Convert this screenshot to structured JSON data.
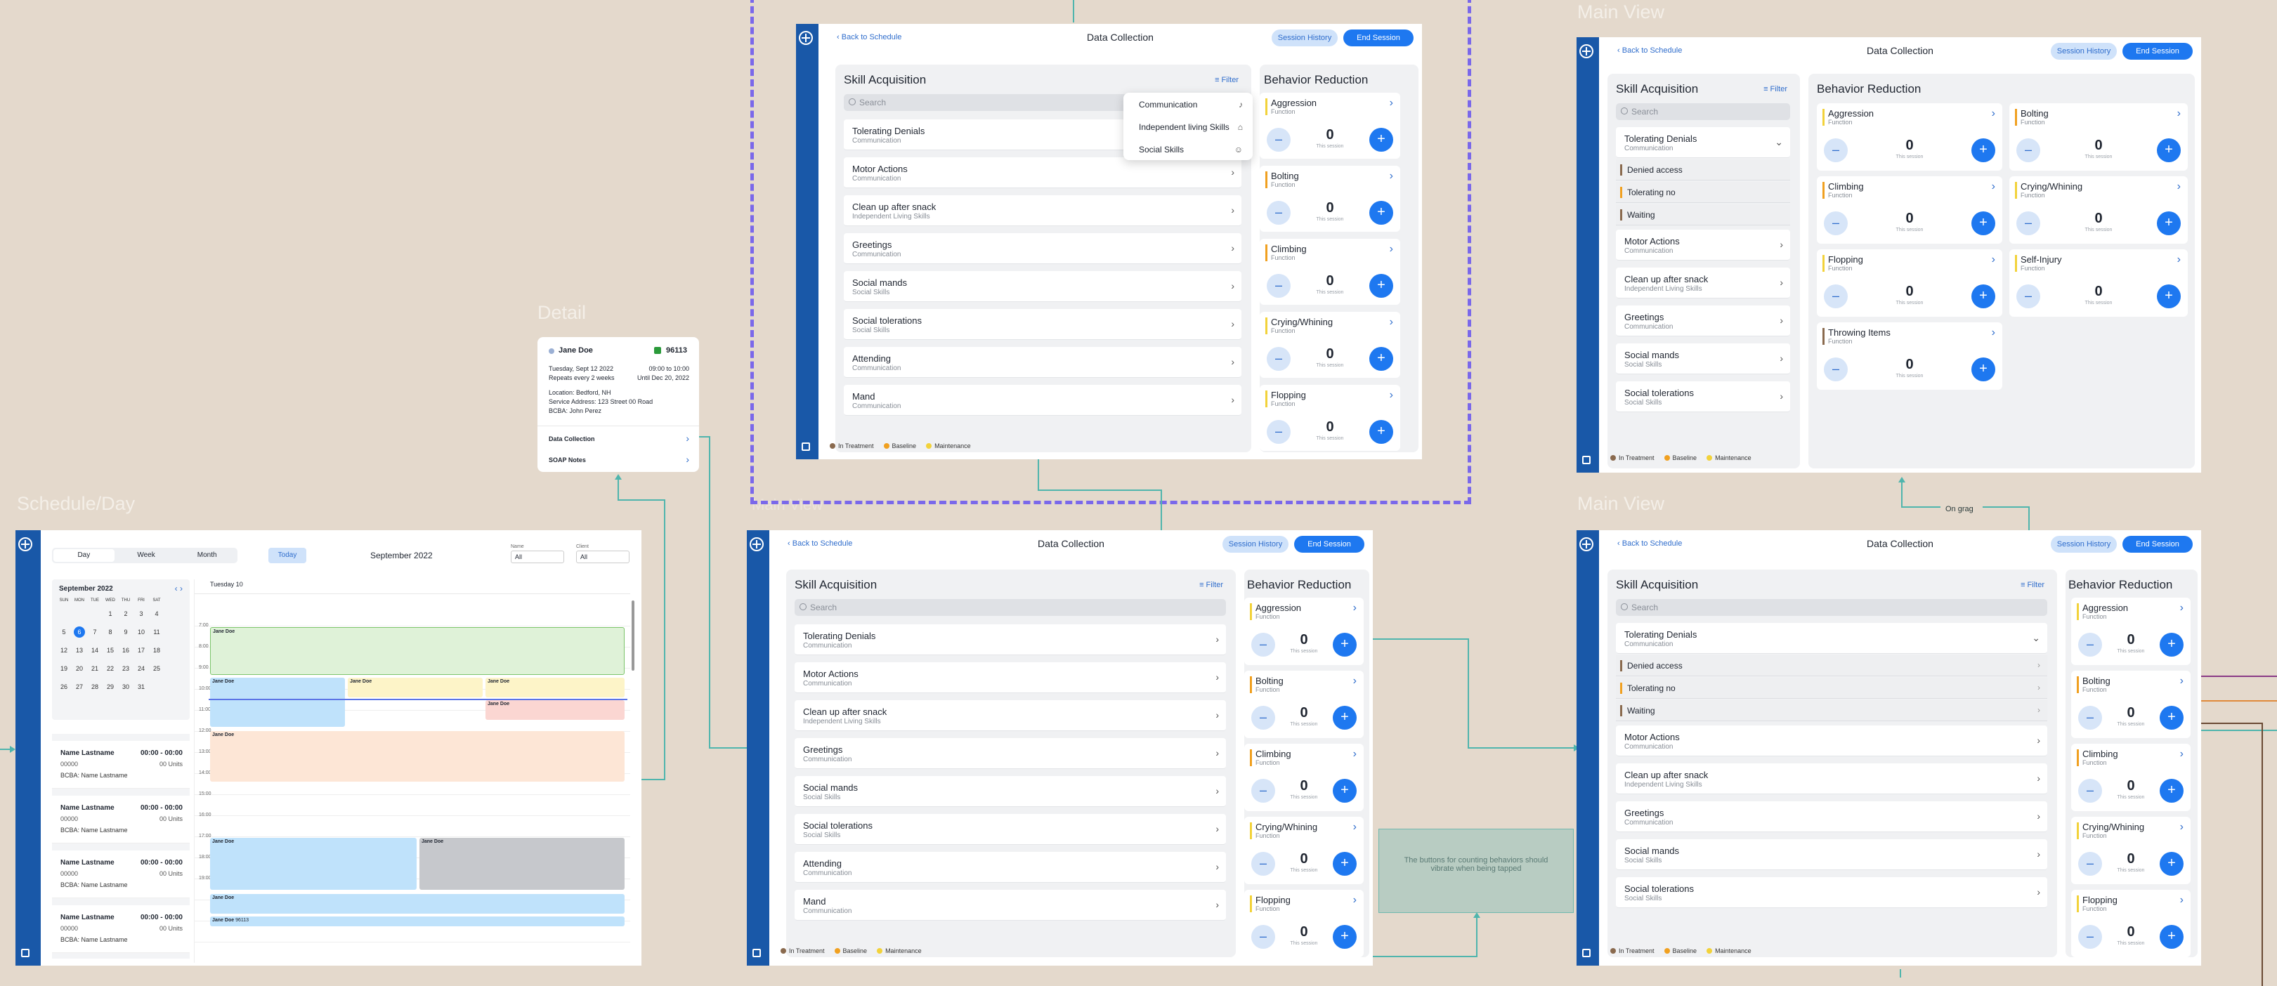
{
  "labels": {
    "main_view_top": "Main View",
    "main_view_bottom": "Main View",
    "detail": "Detail",
    "schedule_day": "Schedule/Day",
    "main_view_faded": "Main View",
    "on_grag": "On grag"
  },
  "common": {
    "back": "Back to Schedule",
    "title": "Data Collection",
    "session_history": "Session History",
    "end_session": "End Session",
    "skill_acquisition": "Skill Acquisition",
    "behavior_reduction": "Behavior Reduction",
    "filter": "Filter",
    "search_placeholder": "Search",
    "this_session": "This session",
    "count": "0",
    "chev": "›",
    "minus": "–",
    "plus": "+",
    "expand_chev": "⌄"
  },
  "legend": [
    {
      "label": "In Treatment",
      "color": "#8a6a4e"
    },
    {
      "label": "Baseline",
      "color": "#f0a020"
    },
    {
      "label": "Maintenance",
      "color": "#f2d23a"
    }
  ],
  "skills": [
    {
      "title": "Tolerating Denials",
      "sub": "Communication"
    },
    {
      "title": "Motor Actions",
      "sub": "Communication"
    },
    {
      "title": "Clean up after snack",
      "sub": "Independent Living Skills"
    },
    {
      "title": "Greetings",
      "sub": "Communication"
    },
    {
      "title": "Social mands",
      "sub": "Social Skills"
    },
    {
      "title": "Social tolerations",
      "sub": "Social Skills"
    },
    {
      "title": "Attending",
      "sub": "Communication"
    },
    {
      "title": "Mand",
      "sub": "Communication"
    }
  ],
  "subskills": [
    {
      "title": "Denied access",
      "color": "#8a6a4e"
    },
    {
      "title": "Tolerating no",
      "color": "#f0a020"
    },
    {
      "title": "Waiting",
      "color": "#8a6a4e"
    }
  ],
  "behaviors": [
    {
      "title": "Aggression",
      "sub": "Function",
      "color": "#f2d23a"
    },
    {
      "title": "Bolting",
      "sub": "Function",
      "color": "#f0a020"
    },
    {
      "title": "Climbing",
      "sub": "Function",
      "color": "#f0a020"
    },
    {
      "title": "Crying/Whining",
      "sub": "Function",
      "color": "#f2d23a"
    },
    {
      "title": "Flopping",
      "sub": "Function",
      "color": "#f2d23a"
    },
    {
      "title": "Self-Injury",
      "sub": "Function",
      "color": "#f2d23a"
    },
    {
      "title": "Throwing Items",
      "sub": "Function",
      "color": "#8a6a4e"
    }
  ],
  "filter_options": [
    {
      "label": "Communication"
    },
    {
      "label": "Independent living Skills"
    },
    {
      "label": "Social Skills"
    }
  ],
  "note": "The buttons for counting behaviors should vibrate when being tapped",
  "detail": {
    "name": "Jane Doe",
    "code": "96113",
    "date": "Tuesday, Sept 12 2022",
    "time": "09:00 to 10:00",
    "repeats": "Repeats every 2 weeks",
    "until": "Until Dec 20, 2022",
    "location": "Location: Bedford, NH",
    "address": "Service Address: 123 Street 00 Road",
    "bcba": "BCBA: John Perez",
    "data_collection": "Data Collection",
    "soap_notes": "SOAP Notes"
  },
  "schedule": {
    "tabs": [
      "Day",
      "Week",
      "Month"
    ],
    "today": "Today",
    "month_title": "September 2022",
    "name_label": "Name",
    "client_label": "Client",
    "all": "All",
    "mini_month": "September 2022",
    "weekdays": [
      "SUN",
      "MON",
      "TUE",
      "WED",
      "THU",
      "FRI",
      "SAT"
    ],
    "weeks": [
      [
        "",
        "",
        "",
        "1",
        "2",
        "3",
        "4"
      ],
      [
        "5",
        "6",
        "7",
        "8",
        "9",
        "10",
        "11"
      ],
      [
        "12",
        "13",
        "14",
        "15",
        "16",
        "17",
        "18"
      ],
      [
        "19",
        "20",
        "21",
        "22",
        "23",
        "24",
        "25"
      ],
      [
        "26",
        "27",
        "28",
        "29",
        "30",
        "31",
        ""
      ]
    ],
    "day_header": "Tuesday 10",
    "hours": [
      "7:00",
      "8:00",
      "9:00",
      "10:00",
      "11:00",
      "12:00",
      "13:00",
      "14:00",
      "15:00",
      "16:00",
      "17:00",
      "18:00",
      "19:00"
    ],
    "event_name": "Jane Doe",
    "event_code": "96113",
    "appointments": [
      {
        "name": "Name Lastname",
        "time": "00:00 - 00:00",
        "code": "00000",
        "units": "00 Units",
        "bcba": "BCBA: Name Lastname"
      },
      {
        "name": "Name Lastname",
        "time": "00:00 - 00:00",
        "code": "00000",
        "units": "00 Units",
        "bcba": "BCBA: Name Lastname"
      },
      {
        "name": "Name Lastname",
        "time": "00:00 - 00:00",
        "code": "00000",
        "units": "00 Units",
        "bcba": "BCBA: Name Lastname"
      },
      {
        "name": "Name Lastname",
        "time": "00:00 - 00:00",
        "code": "00000",
        "units": "00 Units",
        "bcba": "BCBA: Name Lastname"
      }
    ]
  }
}
